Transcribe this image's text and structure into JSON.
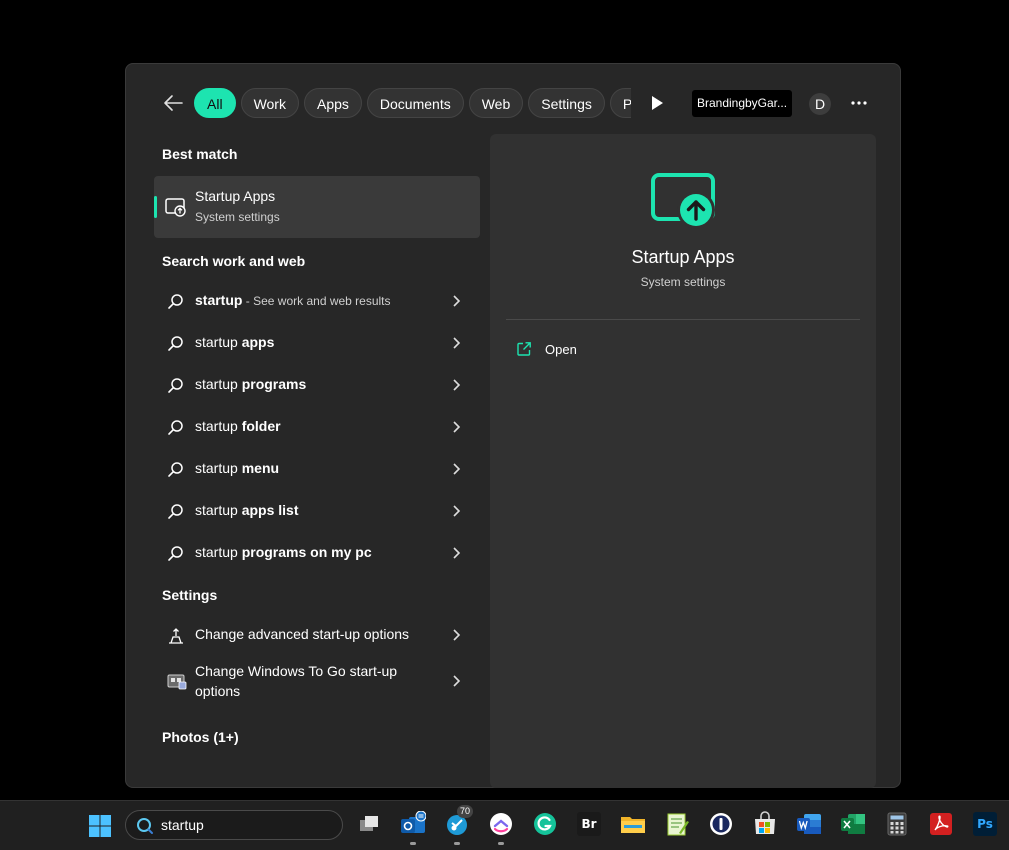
{
  "filters": {
    "chips": [
      {
        "label": "All",
        "active": true
      },
      {
        "label": "Work",
        "active": false
      },
      {
        "label": "Apps",
        "active": false
      },
      {
        "label": "Documents",
        "active": false
      },
      {
        "label": "Web",
        "active": false
      },
      {
        "label": "Settings",
        "active": false
      },
      {
        "label": "Peop",
        "active": false
      }
    ],
    "account_label": "BrandingbyGar...",
    "avatar_letter": "D",
    "more_label": "..."
  },
  "left": {
    "best_match_heading": "Best match",
    "best_match": {
      "title": "Startup Apps",
      "subtitle": "System settings",
      "icon": "startup-apps-icon"
    },
    "search_web_heading": "Search work and web",
    "web_results": [
      {
        "prefix": "startup",
        "bold": "",
        "suffix": " - See work and web results"
      },
      {
        "prefix": "startup ",
        "bold": "apps",
        "suffix": ""
      },
      {
        "prefix": "startup ",
        "bold": "programs",
        "suffix": ""
      },
      {
        "prefix": "startup ",
        "bold": "folder",
        "suffix": ""
      },
      {
        "prefix": "startup ",
        "bold": "menu",
        "suffix": ""
      },
      {
        "prefix": "startup ",
        "bold": "apps list",
        "suffix": ""
      },
      {
        "prefix": "startup ",
        "bold": "programs on my pc",
        "suffix": ""
      }
    ],
    "settings_heading": "Settings",
    "settings": [
      {
        "label": "Change advanced start-up options",
        "icon": "advanced-startup-icon"
      },
      {
        "label": "Change Windows To Go start-up options",
        "icon": "windows-to-go-icon"
      }
    ],
    "photos_heading": "Photos (1+)"
  },
  "right": {
    "title": "Startup Apps",
    "subtitle": "System settings",
    "actions": [
      {
        "label": "Open",
        "icon": "open-external-icon"
      }
    ]
  },
  "taskbar": {
    "search_value": "startup",
    "outlook_badge": "",
    "app_badge": "70",
    "apps": [
      "task-view",
      "outlook",
      "teams-app",
      "clickup",
      "grammarly",
      "bridge",
      "file-explorer",
      "notepad-plus",
      "1password",
      "microsoft-store",
      "word",
      "excel",
      "calculator",
      "acrobat",
      "photoshop"
    ]
  },
  "colors": {
    "accent": "#1de4b0",
    "panel": "#272727",
    "preview": "#313131",
    "taskbar": "#202020"
  }
}
